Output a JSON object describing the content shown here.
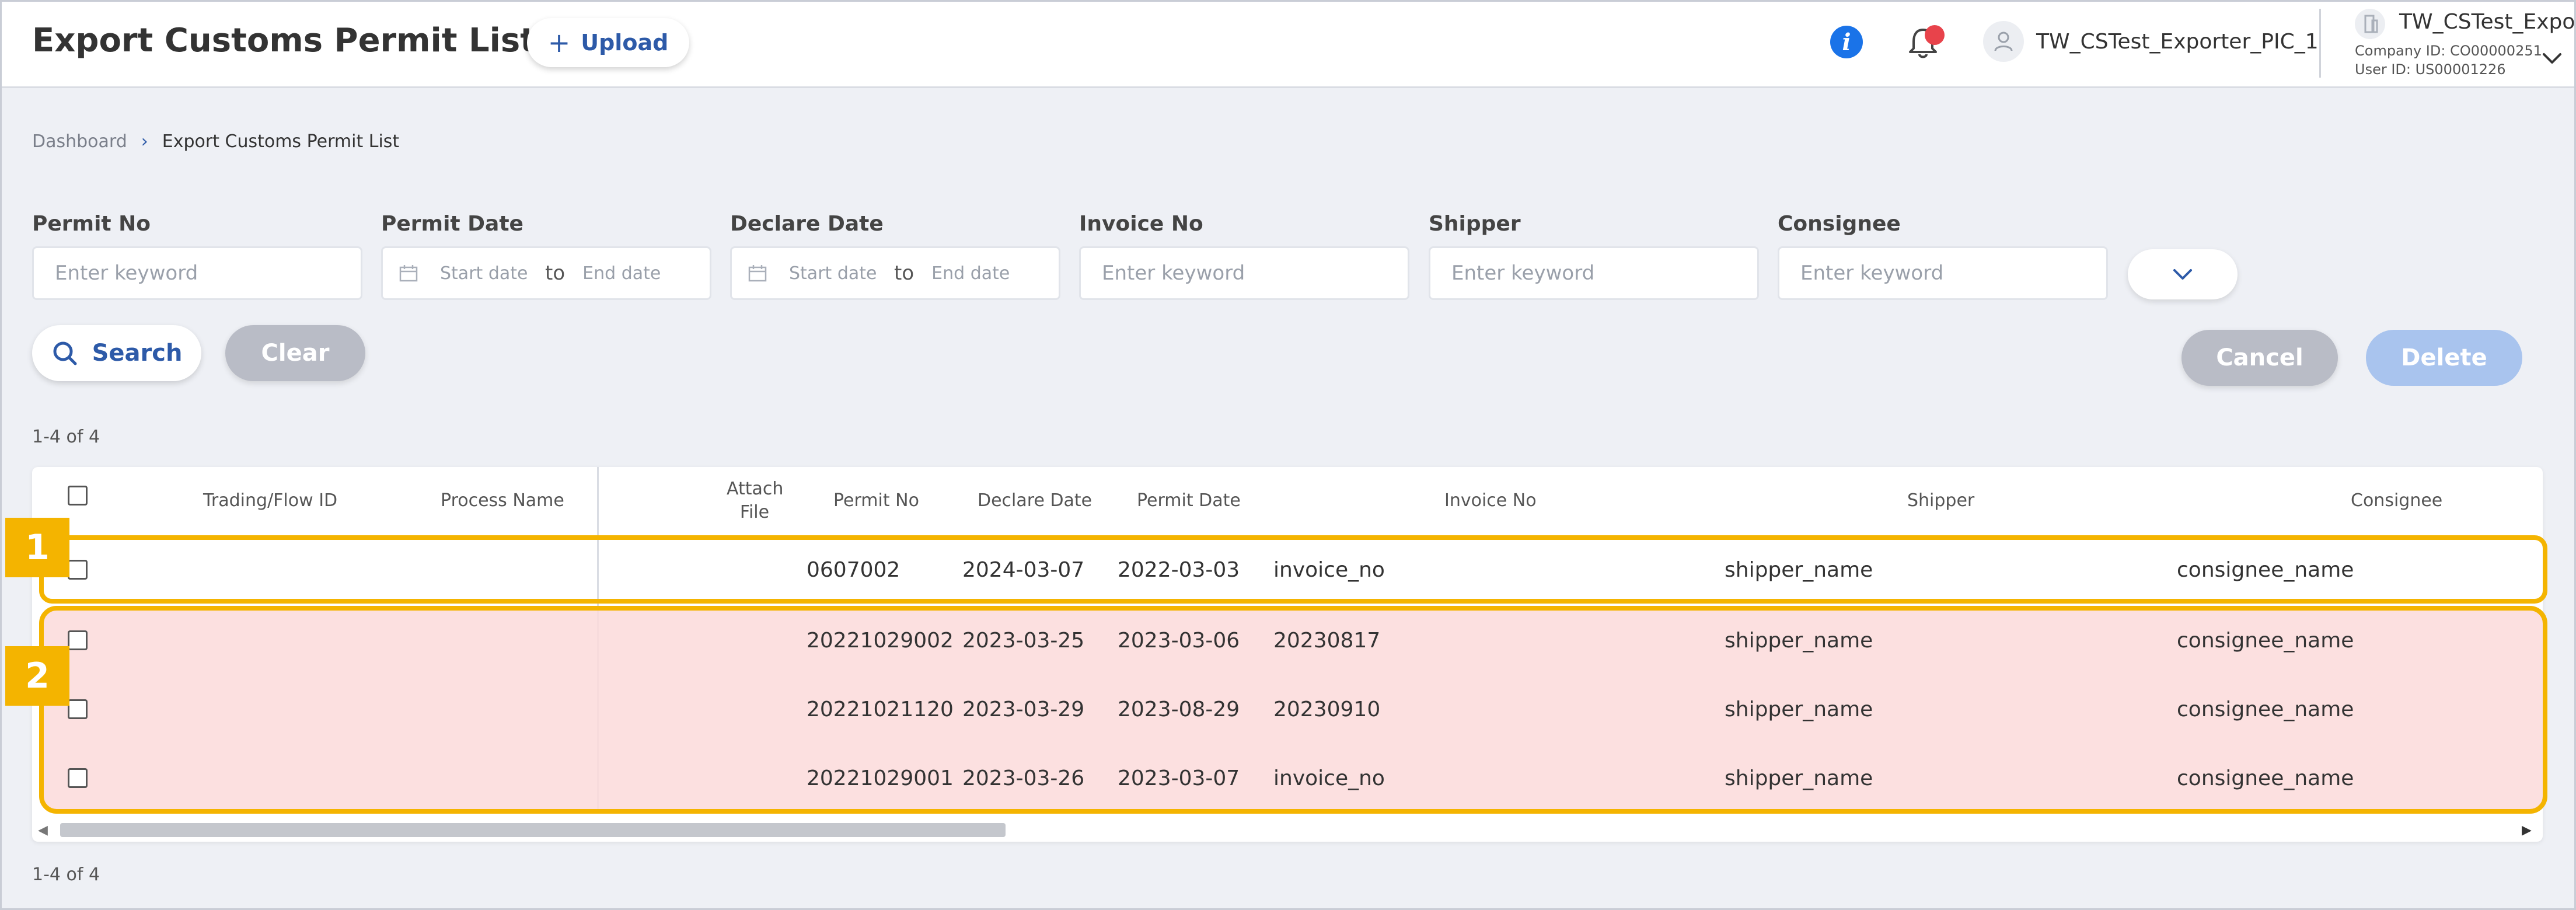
{
  "header": {
    "title": "Export Customs Permit List",
    "upload_label": "Upload",
    "user_name": "TW_CSTest_Exporter_PIC_1",
    "company_name": "TW_CSTest_Expo...",
    "company_id": "Company ID: CO00000251",
    "user_id": "User ID: US00001226"
  },
  "breadcrumb": {
    "home": "Dashboard",
    "current": "Export Customs Permit List"
  },
  "filters": {
    "permit_no": {
      "label": "Permit No",
      "placeholder": "Enter keyword"
    },
    "permit_date": {
      "label": "Permit Date",
      "start": "Start date",
      "to": "to",
      "end": "End date"
    },
    "declare_date": {
      "label": "Declare Date",
      "start": "Start date",
      "to": "to",
      "end": "End date"
    },
    "invoice_no": {
      "label": "Invoice No",
      "placeholder": "Enter keyword"
    },
    "shipper": {
      "label": "Shipper",
      "placeholder": "Enter keyword"
    },
    "consignee": {
      "label": "Consignee",
      "placeholder": "Enter keyword"
    }
  },
  "actions": {
    "search": "Search",
    "clear": "Clear",
    "cancel": "Cancel",
    "delete": "Delete"
  },
  "count_top": "1-4 of 4",
  "count_bottom": "1-4 of 4",
  "table": {
    "headers": {
      "trading_flow_id": "Trading/Flow ID",
      "process_name": "Process Name",
      "attach_file_1": "Attach",
      "attach_file_2": "File",
      "permit_no": "Permit No",
      "declare_date": "Declare Date",
      "permit_date": "Permit Date",
      "invoice_no": "Invoice No",
      "shipper": "Shipper",
      "consignee": "Consignee"
    },
    "rows": [
      {
        "permit_no": "0607002",
        "declare_date": "2024-03-07",
        "permit_date": "2022-03-03",
        "invoice_no": "invoice_no",
        "shipper": "shipper_name",
        "consignee": "consignee_name"
      },
      {
        "permit_no": "20221029002",
        "declare_date": "2023-03-25",
        "permit_date": "2023-03-06",
        "invoice_no": "20230817",
        "shipper": "shipper_name",
        "consignee": "consignee_name"
      },
      {
        "permit_no": "20221021120",
        "declare_date": "2023-03-29",
        "permit_date": "2023-08-29",
        "invoice_no": "20230910",
        "shipper": "shipper_name",
        "consignee": "consignee_name"
      },
      {
        "permit_no": "20221029001",
        "declare_date": "2023-03-26",
        "permit_date": "2023-03-07",
        "invoice_no": "invoice_no",
        "shipper": "shipper_name",
        "consignee": "consignee_name"
      }
    ]
  },
  "annotations": {
    "tag_1": "1",
    "tag_2": "2"
  },
  "icons": {
    "info": "info-icon",
    "bell": "bell-icon",
    "avatar": "user-icon",
    "company": "building-icon",
    "chevron": "chevron-down-icon",
    "search": "search-icon",
    "calendar": "calendar-icon",
    "plus": "plus-icon"
  },
  "colors": {
    "accent": "#2d5aa8",
    "highlight": "#f4b400",
    "highlight_fill": "#fcdada",
    "notification": "#e8434b",
    "disabled_button": "#b9bcc6",
    "delete_button": "#a9c4ee"
  }
}
